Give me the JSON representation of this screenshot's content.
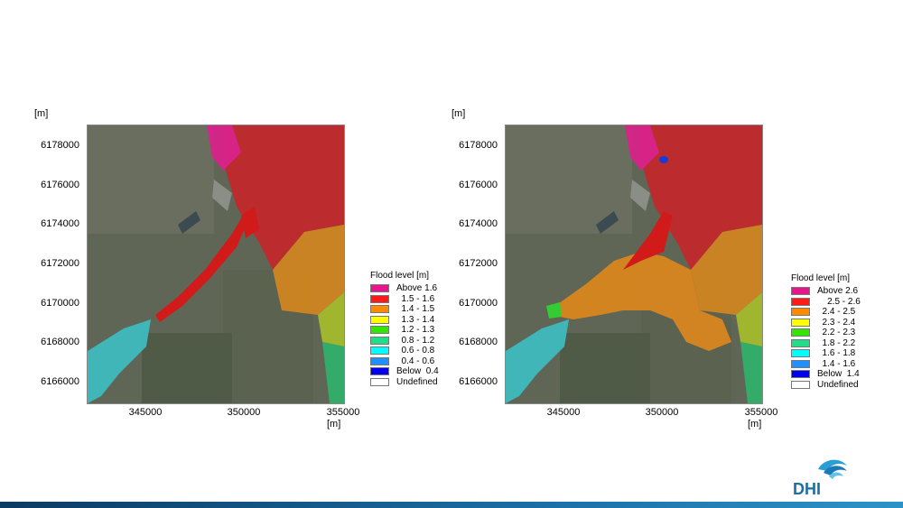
{
  "maps": [
    {
      "y_unit": "[m]",
      "x_unit": "[m]",
      "y_ticks": [
        "6178000",
        "6176000",
        "6174000",
        "6172000",
        "6170000",
        "6168000",
        "6166000"
      ],
      "x_ticks": [
        "345000",
        "350000",
        "355000"
      ],
      "legend": {
        "title": "Flood level [m]",
        "items": [
          {
            "label": "Above 1.6",
            "color": "#e8168c"
          },
          {
            "label": "  1.5 - 1.6",
            "color": "#ff1a1a"
          },
          {
            "label": "  1.4 - 1.5",
            "color": "#ff8a00"
          },
          {
            "label": "  1.3 - 1.4",
            "color": "#ffff00"
          },
          {
            "label": "  1.2 - 1.3",
            "color": "#33e600"
          },
          {
            "label": "  0.8 - 1.2",
            "color": "#22dd88"
          },
          {
            "label": "  0.6 - 0.8",
            "color": "#00ffff"
          },
          {
            "label": "  0.4 - 0.6",
            "color": "#1e90ff"
          },
          {
            "label": "Below  0.4",
            "color": "#0000ee"
          },
          {
            "label": "Undefined",
            "color": "#ffffff"
          }
        ]
      }
    },
    {
      "y_unit": "[m]",
      "x_unit": "[m]",
      "y_ticks": [
        "6178000",
        "6176000",
        "6174000",
        "6172000",
        "6170000",
        "6168000",
        "6166000"
      ],
      "x_ticks": [
        "345000",
        "350000",
        "355000"
      ],
      "legend": {
        "title": "Flood level [m]",
        "items": [
          {
            "label": "Above 2.6",
            "color": "#e8168c"
          },
          {
            "label": "    2.5 - 2.6",
            "color": "#ff1a1a"
          },
          {
            "label": "  2.4 - 2.5",
            "color": "#ff8a00"
          },
          {
            "label": "  2.3 - 2.4",
            "color": "#ffff00"
          },
          {
            "label": "  2.2 - 2.3",
            "color": "#33e600"
          },
          {
            "label": "  1.8 - 2.2",
            "color": "#22dd88"
          },
          {
            "label": "  1.6 - 1.8",
            "color": "#00ffff"
          },
          {
            "label": "  1.4 - 1.6",
            "color": "#1e90ff"
          },
          {
            "label": "Below  1.4",
            "color": "#0000ee"
          },
          {
            "label": "Undefined",
            "color": "#ffffff"
          }
        ]
      }
    }
  ],
  "logo": {
    "text": "DHI"
  }
}
